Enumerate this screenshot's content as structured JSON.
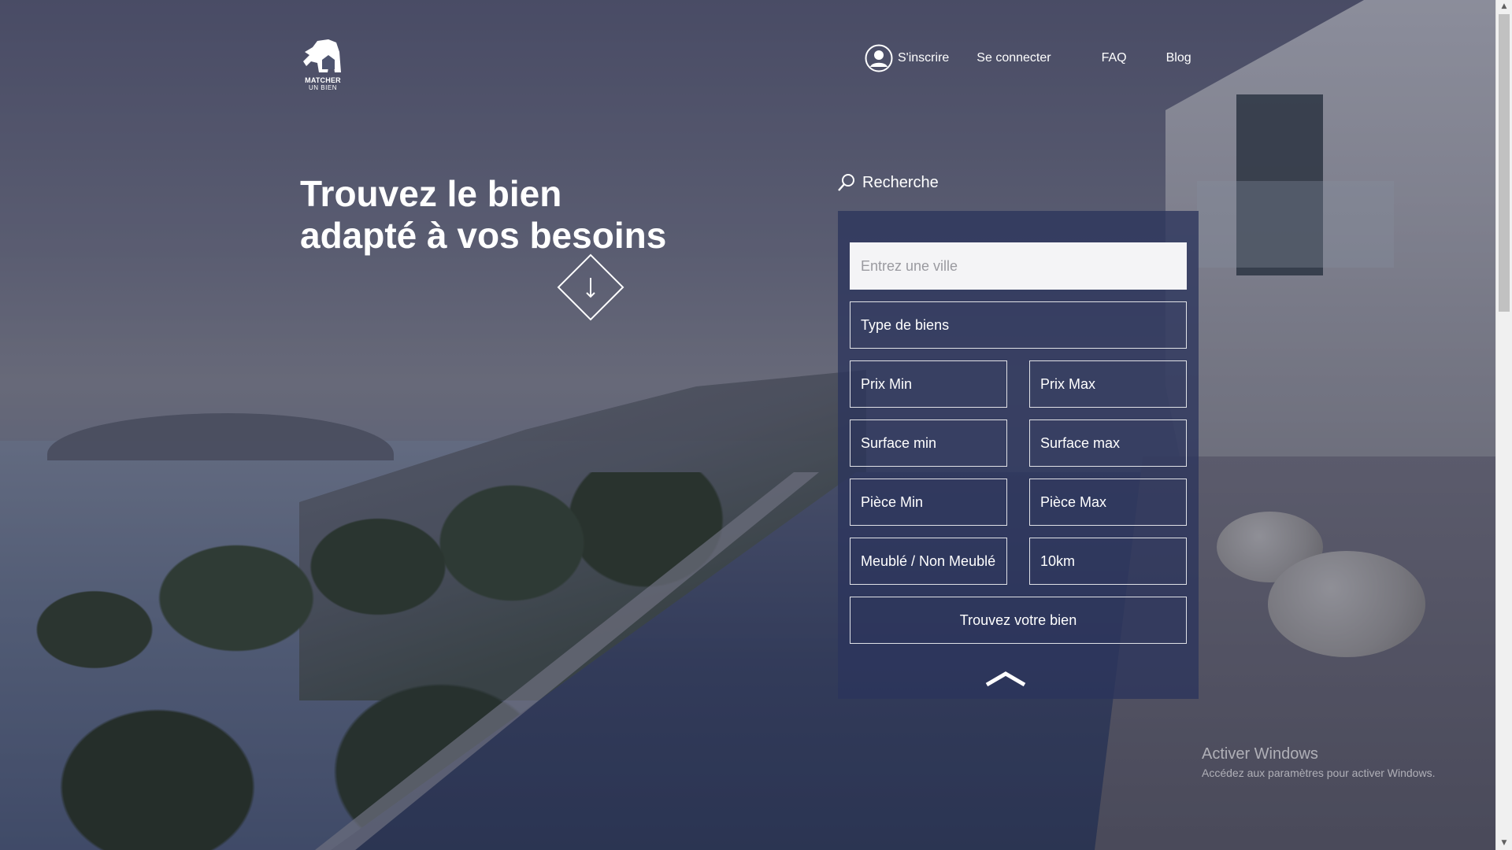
{
  "logo": {
    "line1": "MATCHER",
    "line2": "UN BIEN"
  },
  "nav": {
    "signup_label": "S'inscrire",
    "login_label": "Se connecter",
    "faq_label": "FAQ",
    "blog_label": "Blog"
  },
  "hero": {
    "title_line1": "Trouvez le bien",
    "title_line2": "adapté à vos besoins"
  },
  "search": {
    "heading": "Recherche",
    "city_placeholder": "Entrez une ville",
    "type_label": "Type de biens",
    "price_min_placeholder": "Prix Min",
    "price_max_placeholder": "Prix Max",
    "surface_min_placeholder": "Surface min",
    "surface_max_placeholder": "Surface max",
    "rooms_min_placeholder": "Pièce Min",
    "rooms_max_placeholder": "Pièce Max",
    "furnished_label": "Meublé / Non Meublé",
    "radius_label": "10km",
    "submit_label": "Trouvez votre bien"
  },
  "watermark": {
    "title": "Activer Windows",
    "subtitle": "Accédez aux paramètres pour activer Windows."
  },
  "icons": {
    "logo": "hand-house-logo",
    "user": "user-circle-icon",
    "search": "magnifier-icon",
    "scroll_down": "arrow-down-diamond-icon",
    "collapse": "chevron-up-icon"
  },
  "colors": {
    "panel": "#2c355c",
    "text": "#ffffff",
    "city_input_bg": "#f4f4f6"
  }
}
